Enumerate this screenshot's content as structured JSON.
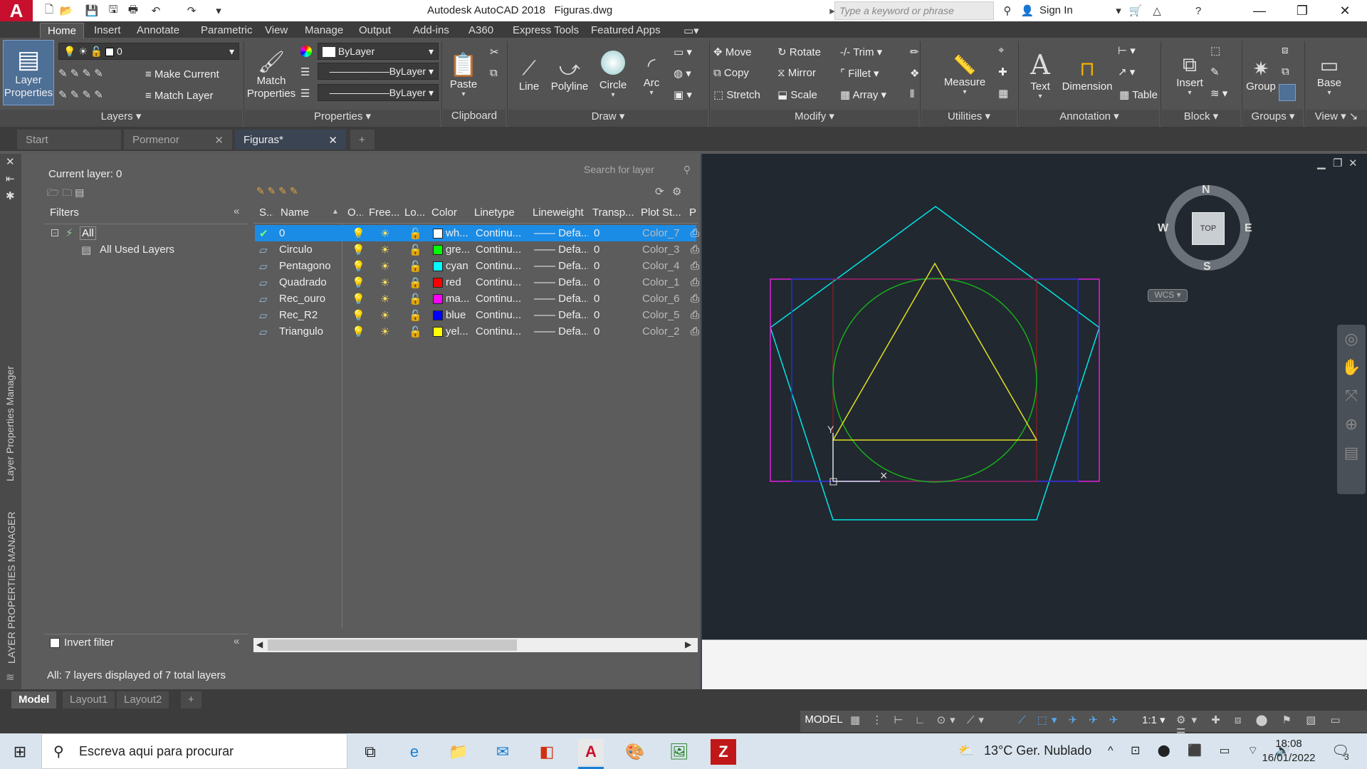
{
  "title_bar": {
    "app_title": "Autodesk AutoCAD 2018",
    "file_name": "Figuras.dwg",
    "search_placeholder": "Type a keyword or phrase",
    "sign_in": "Sign In"
  },
  "ribbon_tabs": [
    "Home",
    "Insert",
    "Annotate",
    "Parametric",
    "View",
    "Manage",
    "Output",
    "Add-ins",
    "A360",
    "Express Tools",
    "Featured Apps"
  ],
  "ribbon": {
    "layers": {
      "layer_properties": "Layer Properties",
      "make_current": "Make Current",
      "match_layer": "Match Layer",
      "current_layer_value": "0",
      "title": "Layers"
    },
    "properties": {
      "match_properties": "Match Properties",
      "color": "ByLayer",
      "linetype": "ByLayer",
      "lineweight": "ByLayer",
      "title": "Properties"
    },
    "clipboard": {
      "paste": "Paste",
      "title": "Clipboard"
    },
    "draw": {
      "line": "Line",
      "polyline": "Polyline",
      "circle": "Circle",
      "arc": "Arc",
      "title": "Draw"
    },
    "modify": {
      "move": "Move",
      "rotate": "Rotate",
      "trim": "Trim",
      "copy": "Copy",
      "mirror": "Mirror",
      "fillet": "Fillet",
      "stretch": "Stretch",
      "scale": "Scale",
      "array": "Array",
      "title": "Modify"
    },
    "utilities": {
      "measure": "Measure",
      "title": "Utilities"
    },
    "annotation": {
      "text": "Text",
      "dimension": "Dimension",
      "table": "Table",
      "title": "Annotation"
    },
    "block": {
      "insert": "Insert",
      "title": "Block"
    },
    "groups": {
      "group": "Group",
      "title": "Groups"
    },
    "view": {
      "base": "Base",
      "title": "View"
    }
  },
  "doc_tabs": [
    "Start",
    "Pormenor",
    "Figuras*"
  ],
  "layer_manager": {
    "current_layer": "Current layer: 0",
    "search_placeholder": "Search for layer",
    "filters_label": "Filters",
    "tree_all": "All",
    "tree_used": "All Used Layers",
    "invert_filter": "Invert filter",
    "status": "All: 7 layers displayed of 7 total layers",
    "side_title_small": "Layer Properties Manager",
    "side_title_big": "LAYER PROPERTIES MANAGER",
    "columns": [
      "S...",
      "Name",
      "O...",
      "Free...",
      "Lo...",
      "Color",
      "Linetype",
      "Lineweight",
      "Transp...",
      "Plot St...",
      "P"
    ],
    "rows": [
      {
        "name": "0",
        "color_name": "wh...",
        "color_hex": "#ffffff",
        "linetype": "Continu...",
        "lineweight": "Defa...",
        "transparency": "0",
        "plot_style": "Color_7"
      },
      {
        "name": "Circulo",
        "color_name": "gre...",
        "color_hex": "#00ff00",
        "linetype": "Continu...",
        "lineweight": "Defa...",
        "transparency": "0",
        "plot_style": "Color_3"
      },
      {
        "name": "Pentagono",
        "color_name": "cyan",
        "color_hex": "#00ffff",
        "linetype": "Continu...",
        "lineweight": "Defa...",
        "transparency": "0",
        "plot_style": "Color_4"
      },
      {
        "name": "Quadrado",
        "color_name": "red",
        "color_hex": "#ff0000",
        "linetype": "Continu...",
        "lineweight": "Defa...",
        "transparency": "0",
        "plot_style": "Color_1"
      },
      {
        "name": "Rec_ouro",
        "color_name": "ma...",
        "color_hex": "#ff00ff",
        "linetype": "Continu...",
        "lineweight": "Defa...",
        "transparency": "0",
        "plot_style": "Color_6"
      },
      {
        "name": "Rec_R2",
        "color_name": "blue",
        "color_hex": "#0000ff",
        "linetype": "Continu...",
        "lineweight": "Defa...",
        "transparency": "0",
        "plot_style": "Color_5"
      },
      {
        "name": "Triangulo",
        "color_name": "yel...",
        "color_hex": "#ffff00",
        "linetype": "Continu...",
        "lineweight": "Defa...",
        "transparency": "0",
        "plot_style": "Color_2"
      }
    ]
  },
  "viewcube": {
    "n": "N",
    "s": "S",
    "e": "E",
    "w": "W",
    "face": "TOP",
    "wcs": "WCS"
  },
  "layout_tabs": [
    "Model",
    "Layout1",
    "Layout2"
  ],
  "status_bar": {
    "model": "MODEL",
    "scale": "1:1"
  },
  "taskbar": {
    "search_text": "Escreva aqui para procurar",
    "weather": "13°C Ger. Nublado",
    "time": "18:08",
    "date": "16/01/2022",
    "notifications": "3"
  }
}
